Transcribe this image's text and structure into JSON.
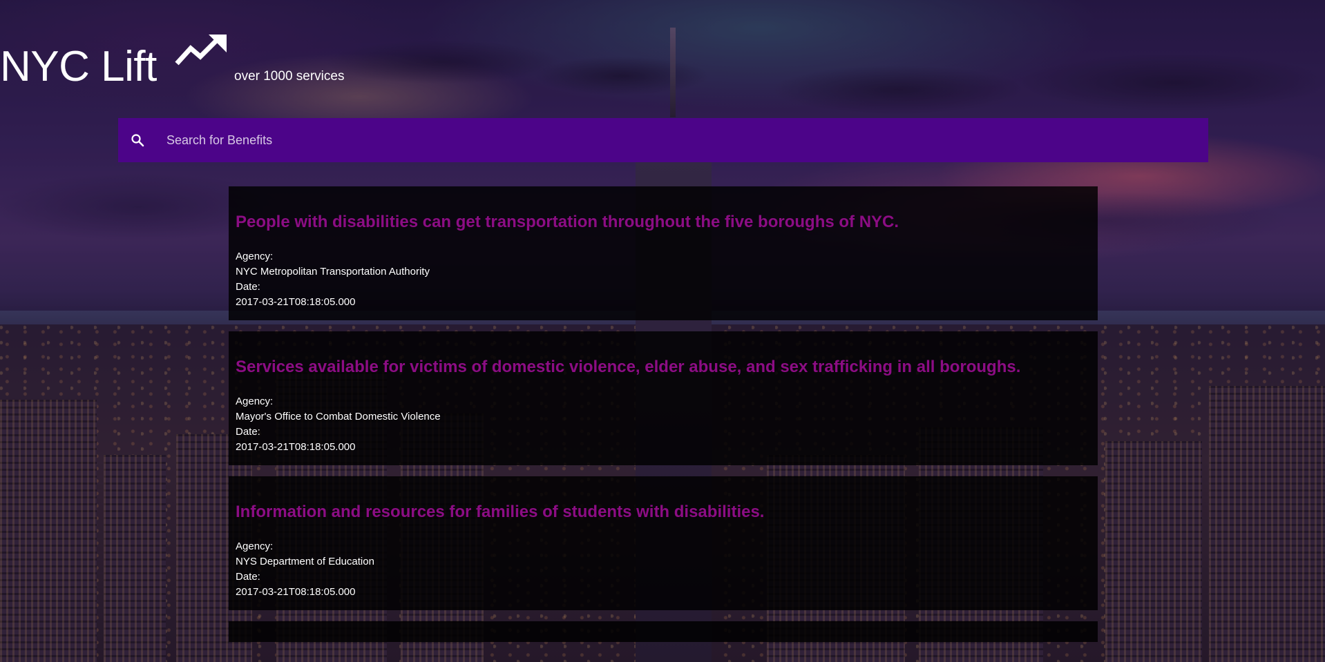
{
  "header": {
    "title": "NYC Lift",
    "subtitle": "over 1000 services",
    "trend_icon": "trending-up-icon"
  },
  "search": {
    "placeholder": "Search for Benefits",
    "value": "",
    "icon": "search-icon"
  },
  "colors": {
    "search_bar": "#4c0489",
    "card_title": "#8c0d84",
    "card_bg": "#000000"
  },
  "labels": {
    "agency": "Agency:",
    "date": "Date:"
  },
  "results": [
    {
      "title": "People with disabilities can get transportation throughout the five boroughs of NYC.",
      "agency": "NYC Metropolitan Transportation Authority",
      "date": "2017-03-21T08:18:05.000"
    },
    {
      "title": "Services available for victims of domestic violence, elder abuse, and sex trafficking in all boroughs.",
      "agency": "Mayor's Office to Combat Domestic Violence",
      "date": "2017-03-21T08:18:05.000"
    },
    {
      "title": "Information and resources for families of students with disabilities.",
      "agency": "NYS Department of Education",
      "date": "2017-03-21T08:18:05.000"
    }
  ]
}
